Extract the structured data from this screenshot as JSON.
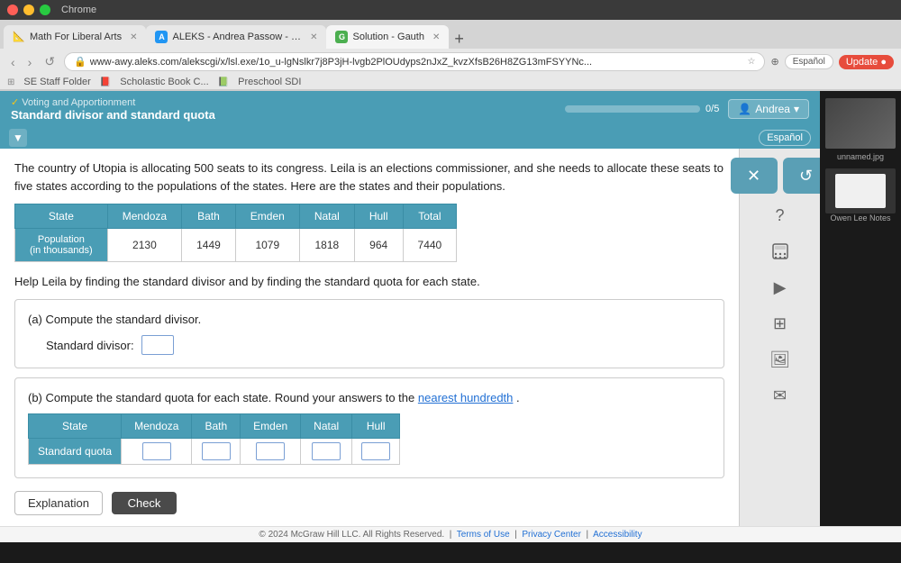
{
  "titlebar": {
    "app": "Chrome"
  },
  "tabs": [
    {
      "label": "Math For Liberal Arts",
      "icon": "📐",
      "active": false
    },
    {
      "label": "ALEKS - Andrea Passow - Le...",
      "icon": "A",
      "active": false
    },
    {
      "label": "Solution - Gauth",
      "icon": "G",
      "active": true
    }
  ],
  "url": "www-awy.aleks.com/alekscgi/x/lsl.exe/1o_u-lgNslkr7j8P3jH-lvgb2PlOUdyps2nJxZ_kvzXfsB26H8ZG13mFSYYNc...",
  "bookmarks": [
    "SE Staff Folder",
    "Scholastic Book C...",
    "Preschool SDI"
  ],
  "header": {
    "breadcrumb": "Voting and Apportionment",
    "title": "Standard divisor and standard quota",
    "progress": "0/5",
    "user": "Andrea",
    "espanol": "Español"
  },
  "problem": {
    "text": "The country of Utopia is allocating 500 seats to its congress. Leila is an elections commissioner, and she needs to allocate these seats to five states according to the populations of the states. Here are the states and their populations.",
    "help_text": "Help Leila by finding the standard divisor and by finding the standard quota for each state.",
    "table": {
      "headers": [
        "State",
        "Mendoza",
        "Bath",
        "Emden",
        "Natal",
        "Hull",
        "Total"
      ],
      "rows": [
        {
          "label": "Population\n(in thousands)",
          "values": [
            "2130",
            "1449",
            "1079",
            "1818",
            "964",
            "7440"
          ]
        }
      ]
    },
    "part_a": {
      "label": "(a)  Compute the standard divisor.",
      "field_label": "Standard divisor:"
    },
    "part_b": {
      "label": "(b)  Compute the standard quota for each state. Round your answers to the",
      "link_text": "nearest hundredth",
      "label_end": ".",
      "quota_table": {
        "headers": [
          "State",
          "Mendoza",
          "Bath",
          "Emden",
          "Natal",
          "Hull"
        ],
        "rows": [
          {
            "label": "Standard quota",
            "values": [
              "",
              "",
              "",
              "",
              ""
            ]
          }
        ]
      }
    }
  },
  "buttons": {
    "explanation": "Explanation",
    "check": "Check",
    "close_icon": "✕",
    "reset_icon": "↺"
  },
  "footer": {
    "text": "© 2024 McGraw Hill LLC. All Rights Reserved.",
    "terms": "Terms of Use",
    "privacy": "Privacy Center",
    "accessibility": "Accessibility"
  },
  "right_panel_icons": [
    "?",
    "▦",
    "▶",
    "▦",
    "▣",
    "✉"
  ]
}
